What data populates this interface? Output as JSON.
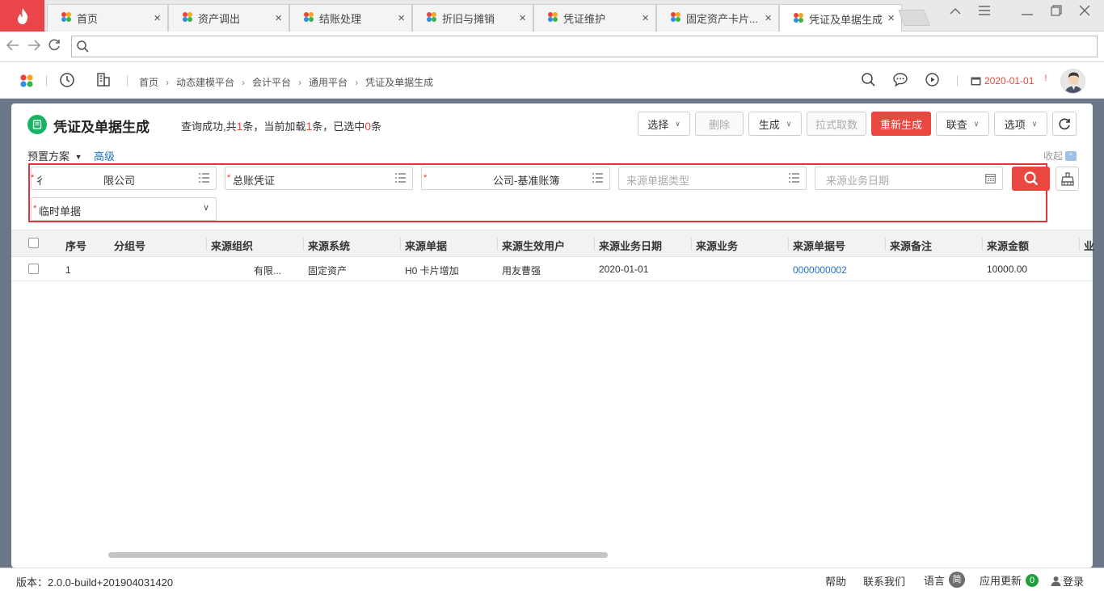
{
  "browser": {
    "tabs": [
      {
        "label": "首页",
        "active": false
      },
      {
        "label": "资产调出",
        "active": false
      },
      {
        "label": "结账处理",
        "active": false
      },
      {
        "label": "折旧与摊销",
        "active": false
      },
      {
        "label": "凭证维护",
        "active": false
      },
      {
        "label": "固定资产卡片...",
        "active": false
      },
      {
        "label": "凭证及单据生成",
        "active": true
      }
    ],
    "address": ""
  },
  "header": {
    "breadcrumb": [
      "首页",
      "动态建模平台",
      "会计平台",
      "通用平台",
      "凭证及单据生成"
    ],
    "date": "2020-01-01",
    "date_alert": "!"
  },
  "page": {
    "title": "凭证及单据生成",
    "status": {
      "p1": "查询成功,共",
      "total": "1",
      "p2": "条，当前加载",
      "loaded": "1",
      "p3": "条，已选中",
      "selected": "0",
      "p4": "条"
    },
    "toolbar": {
      "select": "选择",
      "delete": "删除",
      "generate": "生成",
      "pull": "拉式取数",
      "regenerate": "重新生成",
      "linked": "联查",
      "options": "选项"
    }
  },
  "filter": {
    "preset": "预置方案",
    "advanced": "高级",
    "collapse": "收起",
    "org": "限公司",
    "org_prefix": "*",
    "org_lead": "彳",
    "voucher_type": "总账凭证",
    "account_book": "公司-基准账簿",
    "source_bill_type_placeholder": "来源单据类型",
    "source_date_placeholder": "来源业务日期",
    "temp_bill": "临时单据"
  },
  "grid": {
    "columns": [
      "序号",
      "分组号",
      "来源组织",
      "来源系统",
      "来源单据",
      "来源生效用户",
      "来源业务日期",
      "来源业务",
      "来源单据号",
      "来源备注",
      "来源金额",
      "业"
    ],
    "rows": [
      {
        "index": "1",
        "group": "",
        "org": "有限...",
        "system": "固定资产",
        "bill": "H0 卡片增加",
        "user": "用友曹强",
        "date": "2020-01-01",
        "business": "",
        "bill_no": "0000000002",
        "remark": "",
        "amount": "10000.00"
      }
    ]
  },
  "footer": {
    "version": "版本：2.0.0-build+201904031420",
    "help": "帮助",
    "contact": "联系我们",
    "language": "语言",
    "language_badge": "简",
    "update": "应用更新",
    "update_count": "0",
    "login": "登录"
  },
  "colors": {
    "accent": "#e9473f",
    "link": "#1f73c7",
    "band": "#6b7689",
    "title_icon": "#19b265"
  }
}
